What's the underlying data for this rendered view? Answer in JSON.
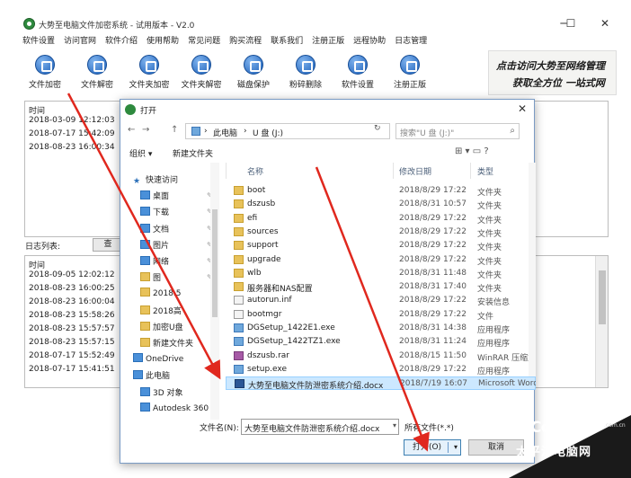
{
  "window": {
    "title": "大势至电脑文件加密系统 - 试用版本 - V2.0",
    "minimize": "─",
    "maximize": "☐",
    "close": "✕"
  },
  "menu": [
    "软件设置",
    "访问官网",
    "软件介绍",
    "使用帮助",
    "常见问题",
    "购买流程",
    "联系我们",
    "注册正版",
    "远程协助",
    "日志管理"
  ],
  "toolbar": [
    "文件加密",
    "文件解密",
    "文件夹加密",
    "文件夹解密",
    "磁盘保护",
    "粉碎删除",
    "软件设置",
    "注册正版"
  ],
  "banner": {
    "line1": "点击访问大势至网络管理",
    "line2": "获取全方位 一站式网"
  },
  "top_panel": {
    "header": "时间",
    "rows": [
      "2018-03-09 12:12:03",
      "2018-07-17 15:42:09",
      "2018-08-23 16:00:34"
    ]
  },
  "log": {
    "label": "日志列表:",
    "query": "查"
  },
  "bottom_panel": {
    "header": "时间",
    "rows": [
      "2018-09-05 12:02:12",
      "2018-08-23 16:00:25",
      "2018-08-23 16:00:04",
      "2018-08-23 15:58:26",
      "2018-08-23 15:57:57",
      "2018-08-23 15:57:15",
      "2018-07-17 15:52:49",
      "2018-07-17 15:41:51"
    ]
  },
  "dialog": {
    "title": "打开",
    "close": "✕",
    "nav": {
      "back": "←",
      "forward": "→",
      "up": "↑"
    },
    "address": [
      "此电脑",
      "U 盘 (J:)"
    ],
    "address_sep": "›",
    "refresh": "↻",
    "search_placeholder": "搜索\"U 盘 (J:)\"",
    "search_icon": "⌕",
    "organize": "组织 ▾",
    "new_folder": "新建文件夹",
    "view_icons": "⊞ ▾  ▭  ?",
    "nav_items": [
      {
        "label": "快速访问",
        "icon": "star"
      },
      {
        "label": "桌面",
        "icon": "blue",
        "pin": true
      },
      {
        "label": "下载",
        "icon": "blue",
        "pin": true
      },
      {
        "label": "文档",
        "icon": "blue",
        "pin": true
      },
      {
        "label": "图片",
        "icon": "blue",
        "pin": true
      },
      {
        "label": "网络",
        "icon": "blue",
        "pin": true
      },
      {
        "label": "图",
        "icon": "folder",
        "pin": true
      },
      {
        "label": "2018.5",
        "icon": "folder"
      },
      {
        "label": "2018高",
        "icon": "folder"
      },
      {
        "label": "加密U盘",
        "icon": "folder"
      },
      {
        "label": "新建文件夹",
        "icon": "folder"
      },
      {
        "label": "OneDrive",
        "icon": "blue"
      },
      {
        "label": "此电脑",
        "icon": "blue"
      },
      {
        "label": "3D 对象",
        "icon": "blue"
      },
      {
        "label": "Autodesk 360",
        "icon": "blue"
      }
    ],
    "pin_glyph": "✎",
    "columns": {
      "name": "名称",
      "date": "修改日期",
      "type": "类型"
    },
    "files": [
      {
        "name": "boot",
        "date": "2018/8/29 17:22",
        "type": "文件夹",
        "icon": "folder"
      },
      {
        "name": "dszusb",
        "date": "2018/8/31 10:57",
        "type": "文件夹",
        "icon": "folder"
      },
      {
        "name": "efi",
        "date": "2018/8/29 17:22",
        "type": "文件夹",
        "icon": "folder"
      },
      {
        "name": "sources",
        "date": "2018/8/29 17:22",
        "type": "文件夹",
        "icon": "folder"
      },
      {
        "name": "support",
        "date": "2018/8/29 17:22",
        "type": "文件夹",
        "icon": "folder"
      },
      {
        "name": "upgrade",
        "date": "2018/8/29 17:22",
        "type": "文件夹",
        "icon": "folder"
      },
      {
        "name": "wlb",
        "date": "2018/8/31 11:48",
        "type": "文件夹",
        "icon": "folder"
      },
      {
        "name": "服务器和NAS配置",
        "date": "2018/8/31 17:40",
        "type": "文件夹",
        "icon": "folder"
      },
      {
        "name": "autorun.inf",
        "date": "2018/8/29 17:22",
        "type": "安装信息",
        "icon": "file"
      },
      {
        "name": "bootmgr",
        "date": "2018/8/29 17:22",
        "type": "文件",
        "icon": "file"
      },
      {
        "name": "DGSetup_1422E1.exe",
        "date": "2018/8/31 14:38",
        "type": "应用程序",
        "icon": "exe"
      },
      {
        "name": "DGSetup_1422TZ1.exe",
        "date": "2018/8/31 11:24",
        "type": "应用程序",
        "icon": "exe"
      },
      {
        "name": "dszusb.rar",
        "date": "2018/8/15 11:50",
        "type": "WinRAR 压缩文",
        "icon": "rar"
      },
      {
        "name": "setup.exe",
        "date": "2018/8/29 17:22",
        "type": "应用程序",
        "icon": "exe"
      },
      {
        "name": "大势至电脑文件防泄密系统介绍.docx",
        "date": "2018/7/19 16:07",
        "type": "Microsoft Word",
        "icon": "doc",
        "selected": true
      }
    ],
    "filename_label": "文件名(N):",
    "filename_value": "大势至电脑文件防泄密系统介绍.docx",
    "filetype": "所有文件(*.*)",
    "open_button": "打开(O)",
    "cancel_button": "取消",
    "dropdown_glyph": "▾"
  },
  "watermark": {
    "brand": "PConline",
    "domain": ".com.cn",
    "cn": "太平洋电脑网"
  },
  "colors": {
    "arrow": "#e0281e",
    "selection": "#cce8ff",
    "accent": "#1b5fb8"
  }
}
